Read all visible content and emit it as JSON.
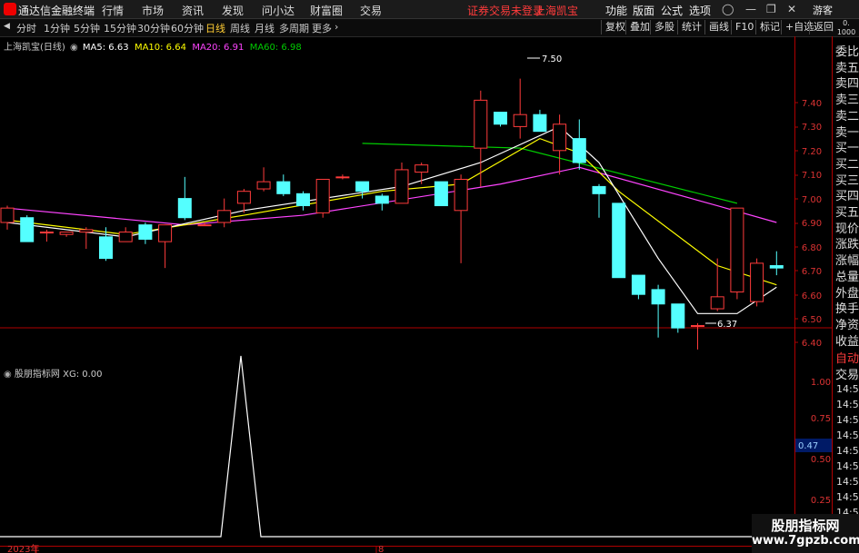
{
  "titlebar": {
    "app_name": "通达信金融终端",
    "menus": [
      "行情",
      "市场",
      "资讯",
      "发现",
      "问小达",
      "财富圈",
      "交易"
    ],
    "alert": "证券交易未登录",
    "stock_name": "上海凯宝",
    "right_menus": [
      "功能",
      "版面",
      "公式",
      "选项"
    ],
    "guest": "游客"
  },
  "periods": [
    "分时",
    "1分钟",
    "5分钟",
    "15分钟",
    "30分钟",
    "60分钟",
    "日线",
    "周线",
    "月线",
    "多周期",
    "更多"
  ],
  "active_period": "日线",
  "toolbar_buttons": [
    "复权",
    "叠加",
    "多股",
    "统计",
    "画线",
    "F10",
    "标记",
    "+自选",
    "返回"
  ],
  "price_info": {
    "title": "上海凯宝(日线)",
    "ma5": "MA5: 6.63",
    "ma10": "MA10: 6.64",
    "ma20": "MA20: 6.91",
    "ma60": "MA60: 6.98",
    "colors": {
      "ma5": "#ffffff",
      "ma10": "#ffff00",
      "ma20": "#ff44ff",
      "ma60": "#00cc00"
    }
  },
  "price_axis": [
    "7.40",
    "7.30",
    "7.20",
    "7.10",
    "7.00",
    "6.90",
    "6.80",
    "6.70",
    "6.60",
    "6.50",
    "6.40"
  ],
  "annotations": {
    "high": "7.50",
    "low": "6.37"
  },
  "indicator": {
    "title": "股朋指标网",
    "xg": "XG: 0.00",
    "axis": [
      "1.00",
      "0.75",
      "0.50",
      "0.25"
    ],
    "cursor_value": "0.47"
  },
  "date_labels": {
    "year": "2023年",
    "month": "8"
  },
  "side_panel": {
    "corner": [
      "0.",
      "1000"
    ],
    "labels": [
      "委比",
      "卖五",
      "卖四",
      "卖三",
      "卖二",
      "卖一",
      "买一",
      "买二",
      "买三",
      "买四",
      "买五",
      "现价",
      "涨跌",
      "涨幅",
      "总量",
      "外盘",
      "换手",
      "净资",
      "收益"
    ],
    "auto_label": "自动",
    "trade_label": "交易",
    "times": [
      "14:5",
      "14:5",
      "14:5",
      "14:5",
      "14:5",
      "14:5",
      "14:5",
      "14:5",
      "14:5"
    ]
  },
  "watermark": {
    "line1": "股朋指标网",
    "line2": "www.7gpzb.com"
  },
  "chart_data": {
    "type": "candlestick",
    "ylim": [
      6.35,
      7.55
    ],
    "candles": [
      {
        "o": 6.9,
        "h": 6.97,
        "l": 6.87,
        "c": 6.96
      },
      {
        "o": 6.92,
        "h": 6.93,
        "l": 6.82,
        "c": 6.82
      },
      {
        "o": 6.86,
        "h": 6.87,
        "l": 6.82,
        "c": 6.86
      },
      {
        "o": 6.85,
        "h": 6.86,
        "l": 6.84,
        "c": 6.86
      },
      {
        "o": 6.86,
        "h": 6.88,
        "l": 6.79,
        "c": 6.87
      },
      {
        "o": 6.84,
        "h": 6.88,
        "l": 6.74,
        "c": 6.75
      },
      {
        "o": 6.82,
        "h": 6.88,
        "l": 6.82,
        "c": 6.86
      },
      {
        "o": 6.89,
        "h": 6.9,
        "l": 6.81,
        "c": 6.83
      },
      {
        "o": 6.82,
        "h": 6.89,
        "l": 6.71,
        "c": 6.89
      },
      {
        "o": 7.0,
        "h": 7.09,
        "l": 6.91,
        "c": 6.92
      },
      {
        "o": 6.89,
        "h": 6.9,
        "l": 6.89,
        "c": 6.89
      },
      {
        "o": 6.9,
        "h": 7.0,
        "l": 6.88,
        "c": 6.95
      },
      {
        "o": 6.98,
        "h": 7.04,
        "l": 6.94,
        "c": 7.03
      },
      {
        "o": 7.04,
        "h": 7.13,
        "l": 7.03,
        "c": 7.07
      },
      {
        "o": 7.07,
        "h": 7.1,
        "l": 7.01,
        "c": 7.02
      },
      {
        "o": 7.02,
        "h": 7.03,
        "l": 6.95,
        "c": 6.97
      },
      {
        "o": 6.94,
        "h": 7.08,
        "l": 6.92,
        "c": 7.08
      },
      {
        "o": 7.09,
        "h": 7.1,
        "l": 7.08,
        "c": 7.09
      },
      {
        "o": 7.07,
        "h": 7.07,
        "l": 7.0,
        "c": 7.03
      },
      {
        "o": 7.01,
        "h": 7.02,
        "l": 6.95,
        "c": 6.98
      },
      {
        "o": 6.98,
        "h": 7.15,
        "l": 6.98,
        "c": 7.12
      },
      {
        "o": 7.11,
        "h": 7.15,
        "l": 7.06,
        "c": 7.14
      },
      {
        "o": 7.07,
        "h": 7.07,
        "l": 6.97,
        "c": 6.97
      },
      {
        "o": 6.95,
        "h": 7.1,
        "l": 6.73,
        "c": 7.08
      },
      {
        "o": 7.21,
        "h": 7.45,
        "l": 7.05,
        "c": 7.41
      },
      {
        "o": 7.36,
        "h": 7.36,
        "l": 7.3,
        "c": 7.31
      },
      {
        "o": 7.3,
        "h": 7.5,
        "l": 7.25,
        "c": 7.35
      },
      {
        "o": 7.35,
        "h": 7.37,
        "l": 7.28,
        "c": 7.28
      },
      {
        "o": 7.2,
        "h": 7.35,
        "l": 7.1,
        "c": 7.31
      },
      {
        "o": 7.25,
        "h": 7.33,
        "l": 7.12,
        "c": 7.15
      },
      {
        "o": 7.05,
        "h": 7.06,
        "l": 6.92,
        "c": 7.02
      },
      {
        "o": 6.98,
        "h": 6.98,
        "l": 6.67,
        "c": 6.67
      },
      {
        "o": 6.68,
        "h": 6.68,
        "l": 6.58,
        "c": 6.6
      },
      {
        "o": 6.62,
        "h": 6.64,
        "l": 6.42,
        "c": 6.56
      },
      {
        "o": 6.56,
        "h": 6.56,
        "l": 6.44,
        "c": 6.46
      },
      {
        "o": 6.47,
        "h": 6.48,
        "l": 6.37,
        "c": 6.47
      },
      {
        "o": 6.54,
        "h": 6.75,
        "l": 6.53,
        "c": 6.59
      },
      {
        "o": 6.61,
        "h": 6.96,
        "l": 6.58,
        "c": 6.96
      },
      {
        "o": 6.57,
        "h": 6.75,
        "l": 6.55,
        "c": 6.73
      },
      {
        "o": 6.72,
        "h": 6.78,
        "l": 6.68,
        "c": 6.71
      }
    ],
    "ma60": [
      [
        18,
        7.23
      ],
      [
        26,
        7.21
      ],
      [
        37,
        6.98
      ]
    ],
    "ma20": [
      [
        0,
        6.96
      ],
      [
        9,
        6.89
      ],
      [
        15,
        6.93
      ],
      [
        25,
        7.06
      ],
      [
        29,
        7.13
      ],
      [
        36,
        6.97
      ],
      [
        39,
        6.9
      ]
    ],
    "ma10": [
      [
        0,
        6.91
      ],
      [
        6,
        6.85
      ],
      [
        12,
        6.93
      ],
      [
        19,
        7.03
      ],
      [
        23,
        7.06
      ],
      [
        27,
        7.25
      ],
      [
        29,
        7.19
      ],
      [
        31,
        7.03
      ],
      [
        36,
        6.72
      ],
      [
        39,
        6.64
      ]
    ],
    "ma5": [
      [
        0,
        6.9
      ],
      [
        6,
        6.84
      ],
      [
        12,
        6.95
      ],
      [
        20,
        7.05
      ],
      [
        24,
        7.15
      ],
      [
        28,
        7.3
      ],
      [
        30,
        7.15
      ],
      [
        33,
        6.75
      ],
      [
        35,
        6.52
      ],
      [
        37,
        6.52
      ],
      [
        39,
        6.63
      ]
    ],
    "xg_signal": {
      "x": [
        0,
        10,
        11,
        12,
        39
      ],
      "y": [
        0,
        0,
        1,
        0,
        0
      ]
    }
  }
}
